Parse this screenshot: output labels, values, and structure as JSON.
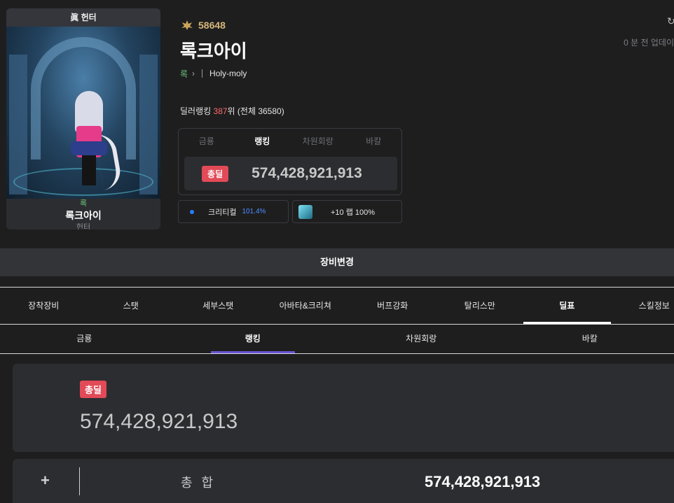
{
  "character": {
    "title_tag": "眞 헌터",
    "server": "록",
    "name": "록크아이",
    "job": "헌터"
  },
  "profile": {
    "fame": "58648",
    "name": "록크아이",
    "server": "록",
    "guild": "Holy-moly",
    "update_text": "0 분 전 업데이"
  },
  "ranking": {
    "label": "딜러랭킹",
    "rank": "387",
    "suffix": "위 (전체 36580)"
  },
  "rank_box": {
    "tabs": [
      "금룡",
      "랭킹",
      "차원회랑",
      "바칼"
    ],
    "active_tab": 1,
    "badge": "총딜",
    "value": "574,428,921,913"
  },
  "mini": {
    "crit_label": "크리티컬",
    "crit_value": "101.4%",
    "level_text": "+10 랩 100%"
  },
  "equip_bar": {
    "label": "장비변경"
  },
  "main_tabs": [
    "장착장비",
    "스탯",
    "세부스탯",
    "아바타&크리쳐",
    "버프강화",
    "탈리스만",
    "딜표",
    "스킬정보"
  ],
  "main_active": 6,
  "sub_tabs": [
    "금룡",
    "랭킹",
    "차원회랑",
    "바칼"
  ],
  "sub_active": 1,
  "total": {
    "badge": "총딜",
    "value": "574,428,921,913"
  },
  "sum_row": {
    "plus": "+",
    "label": "총 합",
    "value": "574,428,921,913"
  },
  "colors": {
    "badge": "#e24a57",
    "accent_tab": "#6b55d9",
    "server": "#6cc17a",
    "rank": "#ff6b6b",
    "crit": "#4e8dff"
  }
}
